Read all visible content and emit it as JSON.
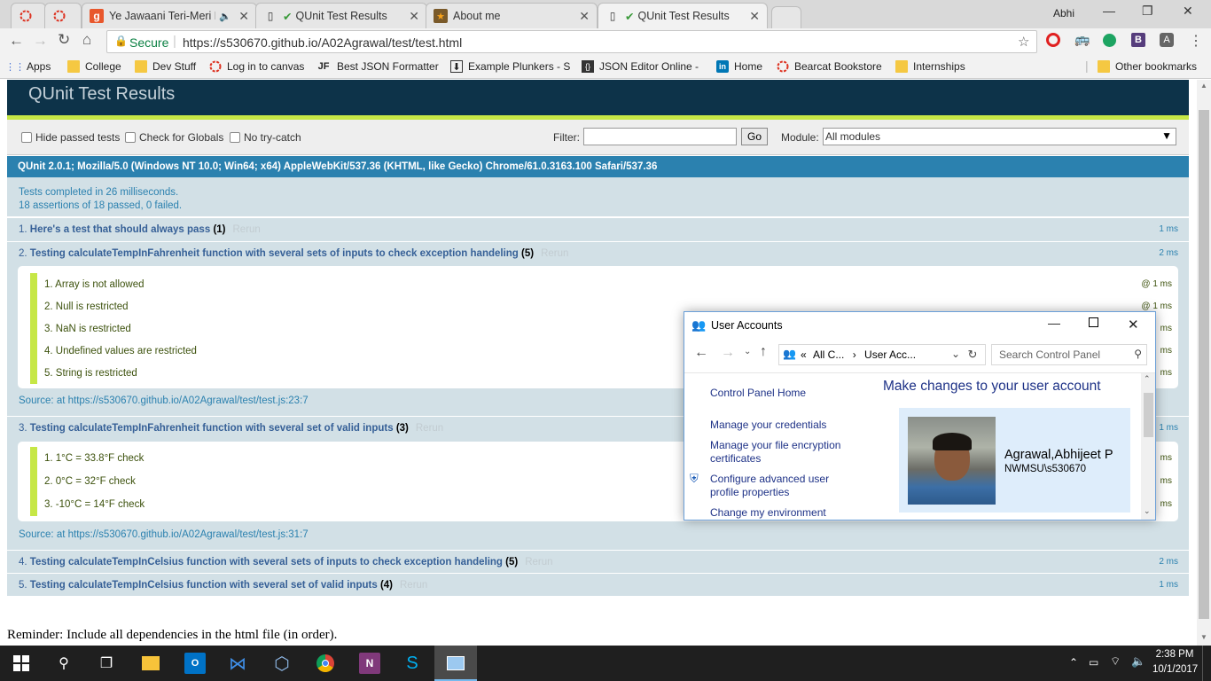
{
  "browser": {
    "tabs": [
      {
        "title": "",
        "icon": "opera-icon",
        "active": false
      },
      {
        "title": "",
        "icon": "opera-icon",
        "active": false
      },
      {
        "title": "Ye Jawaani Teri-Meri P",
        "icon": "gaana-icon",
        "active": false
      },
      {
        "title": "QUnit Test Results",
        "icon": "check-icon",
        "active": false
      },
      {
        "title": "About me",
        "icon": "star-icon",
        "active": false
      },
      {
        "title": "QUnit Test Results",
        "icon": "check-icon",
        "active": true
      }
    ],
    "profile_name": "Abhi",
    "secure_label": "Secure",
    "url": "https://s530670.github.io/A02Agrawal/test/test.html",
    "bookmarks": [
      {
        "label": "Apps",
        "icon": "apps-icon"
      },
      {
        "label": "College",
        "icon": "folder-icon"
      },
      {
        "label": "Dev Stuff",
        "icon": "folder-icon"
      },
      {
        "label": "Log in to canvas",
        "icon": "canvas-icon"
      },
      {
        "label": "Best JSON Formatter",
        "icon": "jf-icon"
      },
      {
        "label": "Example Plunkers - S",
        "icon": "download-icon"
      },
      {
        "label": "JSON Editor Online -",
        "icon": "braces-icon"
      },
      {
        "label": "Home",
        "icon": "linkedin-icon"
      },
      {
        "label": "Bearcat Bookstore",
        "icon": "canvas-icon"
      },
      {
        "label": "Internships",
        "icon": "folder-icon"
      }
    ],
    "other_bookmarks": "Other bookmarks"
  },
  "qunit": {
    "header": "QUnit Test Results",
    "toolbar": {
      "hide_passed": "Hide passed tests",
      "check_globals": "Check for Globals",
      "no_try_catch": "No try-catch",
      "filter_label": "Filter:",
      "go": "Go",
      "module_label": "Module:",
      "module_value": "All modules"
    },
    "userAgent": "QUnit 2.0.1; Mozilla/5.0 (Windows NT 10.0; Win64; x64) AppleWebKit/537.36 (KHTML, like Gecko) Chrome/61.0.3163.100 Safari/537.36",
    "result_line1": "Tests completed in 26 milliseconds.",
    "result_line2": "18 assertions of 18 passed, 0 failed.",
    "rerun": "Rerun",
    "tests": [
      {
        "num": "1.",
        "name": "Here's a test that should always pass",
        "count": "(1)",
        "time": "1 ms"
      },
      {
        "num": "2.",
        "name": "Testing calculateTempInFahrenheit function with several sets of inputs to check exception handeling",
        "count": "(5)",
        "time": "2 ms",
        "asserts": [
          {
            "text": "1. Array is not allowed",
            "time": "@ 1 ms"
          },
          {
            "text": "2. Null is restricted",
            "time": "@ 1 ms"
          },
          {
            "text": "3. NaN is restricted",
            "time": "ms"
          },
          {
            "text": "4. Undefined values are restricted",
            "time": "ms"
          },
          {
            "text": "5. String is restricted",
            "time": "ms"
          }
        ],
        "source": "Source: at https://s530670.github.io/A02Agrawal/test/test.js:23:7"
      },
      {
        "num": "3.",
        "name": "Testing calculateTempInFahrenheit function with several set of valid inputs",
        "count": "(3)",
        "time": "1 ms",
        "asserts": [
          {
            "text": "1. 1°C = 33.8°F check",
            "time": "ms"
          },
          {
            "text": "2. 0°C = 32°F check",
            "time": "ms"
          },
          {
            "text": "3. -10°C = 14°F check",
            "time": "ms"
          }
        ],
        "source": "Source: at https://s530670.github.io/A02Agrawal/test/test.js:31:7"
      },
      {
        "num": "4.",
        "name": "Testing calculateTempInCelsius function with several sets of inputs to check exception handeling",
        "count": "(5)",
        "time": "2 ms"
      },
      {
        "num": "5.",
        "name": "Testing calculateTempInCelsius function with several set of valid inputs",
        "count": "(4)",
        "time": "1 ms"
      }
    ],
    "reminder": "Reminder: Include all dependencies in the html file (in order)."
  },
  "dialog": {
    "title": "User Accounts",
    "crumb_prefix": "«",
    "crumb_1": "All C...",
    "crumb_2": "User Acc...",
    "search_placeholder": "Search Control Panel",
    "links": [
      "Control Panel Home",
      "Manage your credentials",
      "Manage your file encryption certificates",
      "Configure advanced user profile properties",
      "Change my environment"
    ],
    "heading": "Make changes to your user account",
    "user_name": "Agrawal,Abhijeet P",
    "user_domain": "NWMSU\\s530670"
  },
  "taskbar": {
    "time": "2:38 PM",
    "date": "10/1/2017"
  }
}
